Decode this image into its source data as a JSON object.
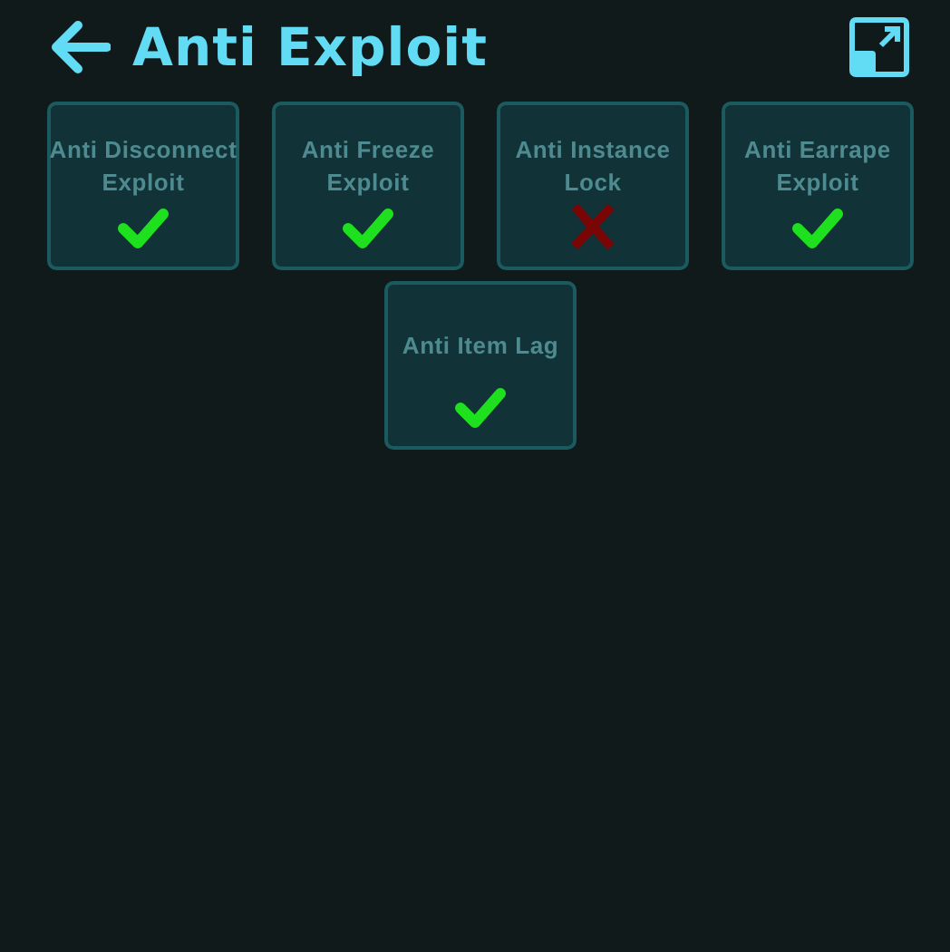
{
  "header": {
    "title": "Anti Exploit"
  },
  "toggles": [
    {
      "label": "Anti Disconnect Exploit",
      "on": true
    },
    {
      "label": "Anti Freeze Exploit",
      "on": true
    },
    {
      "label": "Anti Instance Lock",
      "on": false
    },
    {
      "label": "Anti Earrape Exploit",
      "on": true
    },
    {
      "label": "Anti Item Lag",
      "on": true
    }
  ]
}
